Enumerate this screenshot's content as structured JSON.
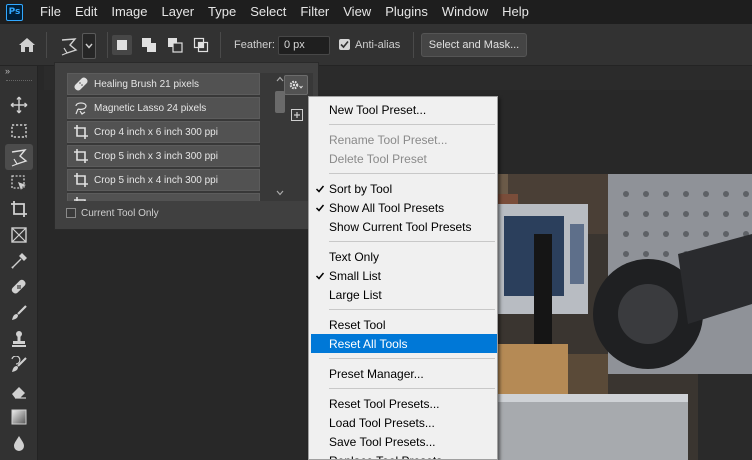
{
  "app": {
    "logo_text": "Ps",
    "menus": [
      "File",
      "Edit",
      "Image",
      "Layer",
      "Type",
      "Select",
      "Filter",
      "View",
      "Plugins",
      "Window",
      "Help"
    ]
  },
  "options_bar": {
    "feather_label": "Feather:",
    "feather_value": "0 px",
    "antialias_label": "Anti-alias",
    "antialias_checked": true,
    "select_mask_label": "Select and Mask..."
  },
  "toolbar": {
    "chevron": "»",
    "tools": [
      "move-tool",
      "marquee-tool",
      "polygonal-lasso-tool",
      "object-selection-tool",
      "crop-tool",
      "frame-tool",
      "eyedropper-tool",
      "healing-brush-tool",
      "brush-tool",
      "clone-stamp-tool",
      "history-brush-tool",
      "eraser-tool",
      "gradient-tool",
      "blur-tool"
    ]
  },
  "preset_panel": {
    "items": [
      {
        "icon": "healing-brush-icon",
        "label": "Healing Brush 21 pixels"
      },
      {
        "icon": "magnetic-lasso-icon",
        "label": "Magnetic Lasso 24 pixels"
      },
      {
        "icon": "crop-icon",
        "label": "Crop 4 inch x 6 inch 300 ppi"
      },
      {
        "icon": "crop-icon",
        "label": "Crop 5 inch x 3 inch 300 ppi"
      },
      {
        "icon": "crop-icon",
        "label": "Crop 5 inch x 4 inch 300 ppi"
      },
      {
        "icon": "crop-icon",
        "label": ""
      }
    ],
    "current_tool_only_label": "Current Tool Only",
    "current_tool_only_checked": false
  },
  "context_menu": {
    "items": [
      {
        "label": "New Tool Preset...",
        "checked": false,
        "disabled": false,
        "highlight": false
      },
      {
        "sep": true
      },
      {
        "label": "Rename Tool Preset...",
        "checked": false,
        "disabled": true,
        "highlight": false
      },
      {
        "label": "Delete Tool Preset",
        "checked": false,
        "disabled": true,
        "highlight": false
      },
      {
        "sep": true
      },
      {
        "label": "Sort by Tool",
        "checked": true,
        "disabled": false,
        "highlight": false
      },
      {
        "label": "Show All Tool Presets",
        "checked": true,
        "disabled": false,
        "highlight": false
      },
      {
        "label": "Show Current Tool Presets",
        "checked": false,
        "disabled": false,
        "highlight": false
      },
      {
        "sep": true
      },
      {
        "label": "Text Only",
        "checked": false,
        "disabled": false,
        "highlight": false
      },
      {
        "label": "Small List",
        "checked": true,
        "disabled": false,
        "highlight": false
      },
      {
        "label": "Large List",
        "checked": false,
        "disabled": false,
        "highlight": false
      },
      {
        "sep": true
      },
      {
        "label": "Reset Tool",
        "checked": false,
        "disabled": false,
        "highlight": false
      },
      {
        "label": "Reset All Tools",
        "checked": false,
        "disabled": false,
        "highlight": true
      },
      {
        "sep": true
      },
      {
        "label": "Preset Manager...",
        "checked": false,
        "disabled": false,
        "highlight": false
      },
      {
        "sep": true
      },
      {
        "label": "Reset Tool Presets...",
        "checked": false,
        "disabled": false,
        "highlight": false
      },
      {
        "label": "Load Tool Presets...",
        "checked": false,
        "disabled": false,
        "highlight": false
      },
      {
        "label": "Save Tool Presets...",
        "checked": false,
        "disabled": false,
        "highlight": false
      },
      {
        "label": "Replace Tool Presets...",
        "checked": false,
        "disabled": false,
        "highlight": false
      }
    ]
  },
  "colors": {
    "highlight": "#0078d7",
    "menu_bg": "#f0f0f0",
    "ui_dark": "#323232"
  }
}
